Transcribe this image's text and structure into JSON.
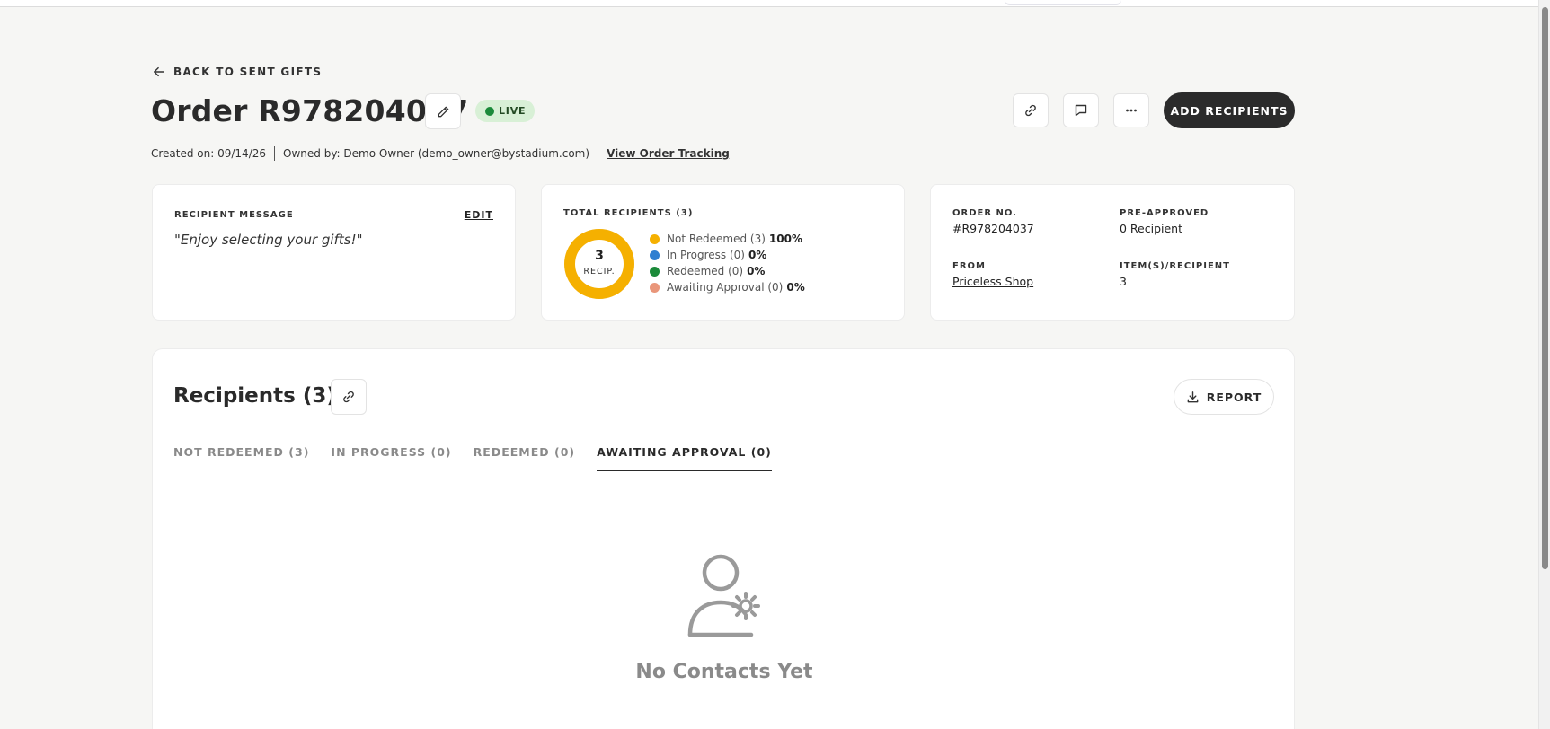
{
  "nav": {
    "back_label": "BACK TO SENT GIFTS"
  },
  "header": {
    "title": "Order R978204037",
    "status": "LIVE",
    "add_recipients_label": "ADD RECIPIENTS",
    "created_on": "Created on: 09/14/26",
    "owned_by": "Owned by: Demo Owner (demo_owner@bystadium.com)",
    "tracking_link": "View Order Tracking"
  },
  "recipient_message": {
    "label": "RECIPIENT MESSAGE",
    "edit_label": "EDIT",
    "message": "\"Enjoy selecting your gifts!\""
  },
  "summary": {
    "label": "TOTAL RECIPIENTS (3)",
    "total": "3",
    "total_label": "RECIP.",
    "legend": [
      {
        "label": "Not Redeemed (3)",
        "pct": "100%",
        "color": "#f5b000",
        "fraction": 1.0
      },
      {
        "label": "In Progress (0)",
        "pct": "0%",
        "color": "#2f7fd1",
        "fraction": 0
      },
      {
        "label": "Redeemed (0)",
        "pct": "0%",
        "color": "#1b8a3a",
        "fraction": 0
      },
      {
        "label": "Awaiting Approval (0)",
        "pct": "0%",
        "color": "#e9967a",
        "fraction": 0
      }
    ]
  },
  "order_info": {
    "order_no_label": "ORDER NO.",
    "order_no": "#R978204037",
    "pre_approved_label": "PRE-APPROVED",
    "pre_approved": "0 Recipient",
    "from_label": "FROM",
    "from": "Priceless Shop",
    "items_label": "ITEM(S)/RECIPIENT",
    "items": "3"
  },
  "recipients": {
    "title": "Recipients (3)",
    "report_label": "REPORT",
    "tabs": [
      {
        "label": "NOT REDEEMED (3)"
      },
      {
        "label": "IN PROGRESS (0)"
      },
      {
        "label": "REDEEMED (0)"
      },
      {
        "label": "AWAITING APPROVAL (0)"
      }
    ],
    "empty_text": "No Contacts Yet"
  }
}
